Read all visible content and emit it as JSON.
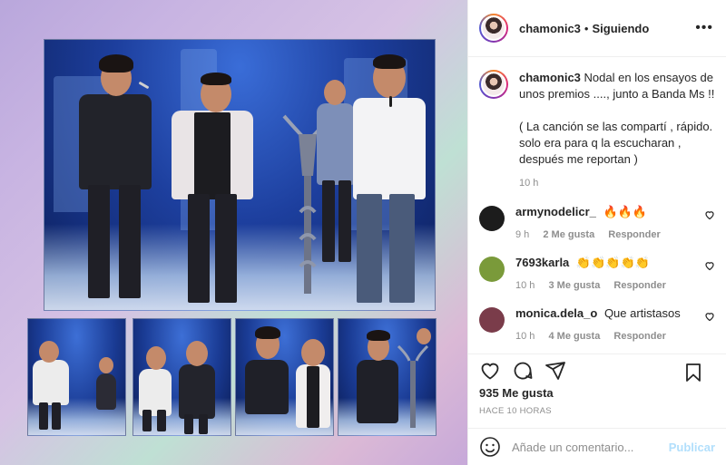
{
  "post": {
    "username": "chamonic3",
    "separator": "•",
    "follow_status": "Siguiendo",
    "more_icon": "more-horizontal-icon"
  },
  "caption": {
    "username": "chamonic3",
    "text": "Nodal en los ensayos de unos premios ...., junto a Banda Ms !!",
    "text2": "( La canción se las compartí , rápido. solo era para q la escucharan , después me reportan )",
    "time": "10 h"
  },
  "comments": [
    {
      "username": "armynodelicr_",
      "text": "🔥🔥🔥",
      "time": "9 h",
      "likes": "2 Me gusta",
      "reply": "Responder",
      "avatar_color": "#1c1c1c"
    },
    {
      "username": "7693karla",
      "text": "👏👏👏👏👏",
      "time": "10 h",
      "likes": "3 Me gusta",
      "reply": "Responder",
      "avatar_color": "#7a9a3a"
    },
    {
      "username": "monica.dela_o",
      "text": "Que artistasos",
      "time": "10 h",
      "likes": "4 Me gusta",
      "reply": "Responder",
      "avatar_color": "#7a3c4a"
    }
  ],
  "actions": {
    "like_icon": "heart-icon",
    "comment_icon": "comment-icon",
    "share_icon": "share-icon",
    "save_icon": "bookmark-icon"
  },
  "likes_count": "935 Me gusta",
  "time_ago": "HACE 10 HORAS",
  "add_comment": {
    "placeholder": "Añade un comentario...",
    "publish_label": "Publicar",
    "emoji_icon": "smile-icon"
  },
  "colors": {
    "text": "#262626",
    "secondary": "#8e8e8e",
    "border": "#efefef",
    "publish_disabled": "#b2dffc"
  }
}
